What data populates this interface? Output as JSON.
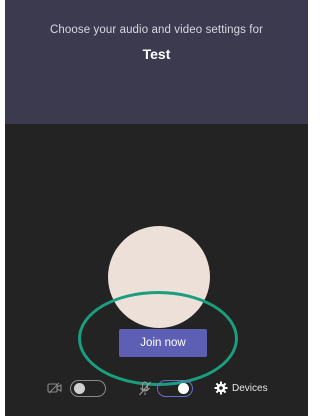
{
  "header": {
    "subtitle": "Choose your audio and video settings for",
    "meeting_title": "Test"
  },
  "preview": {
    "join_button_label": "Join now"
  },
  "controls": {
    "video_toggle": {
      "state": "off",
      "icon": "camera-off-icon"
    },
    "audio_toggle": {
      "state": "on",
      "icon": "mic-off-icon"
    },
    "devices_label": "Devices",
    "devices_icon": "gear-icon"
  },
  "colors": {
    "header_bg": "#3b3a4f",
    "preview_bg": "#232323",
    "join_button_bg": "#5d5fb4",
    "avatar_fill": "#ece0d9",
    "highlight_ring": "#1b9e7f"
  }
}
